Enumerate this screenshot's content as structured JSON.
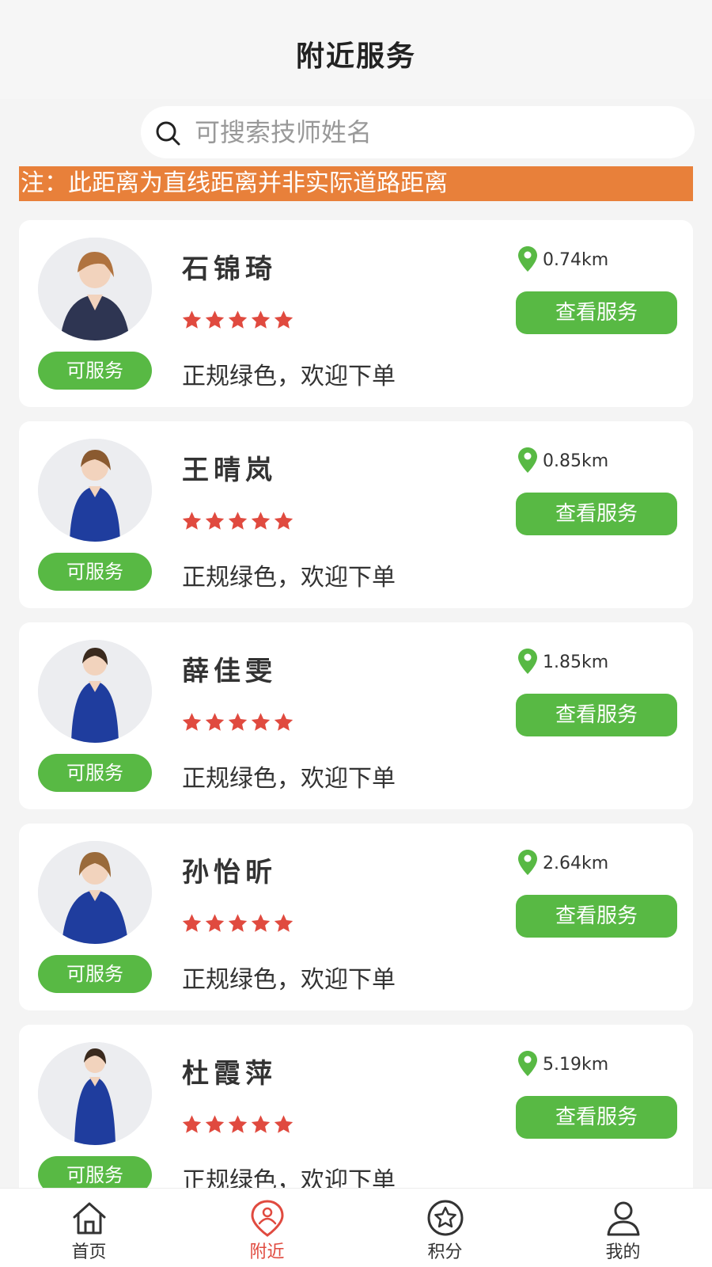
{
  "header": {
    "title": "附近服务"
  },
  "search": {
    "placeholder": "可搜索技师姓名"
  },
  "notice": "注：此距离为直线距离并非实际道路距离",
  "colors": {
    "accent_green": "#58b944",
    "notice_orange": "#e8803a",
    "star_red": "#e04a3f",
    "active_tab": "#e04a3f"
  },
  "technicians": [
    {
      "name": "石锦琦",
      "rating": 5,
      "distance": "0.74km",
      "status": "可服务",
      "description": "正规绿色，欢迎下单",
      "action": "查看服务"
    },
    {
      "name": "王晴岚",
      "rating": 5,
      "distance": "0.85km",
      "status": "可服务",
      "description": "正规绿色，欢迎下单",
      "action": "查看服务"
    },
    {
      "name": "薛佳雯",
      "rating": 5,
      "distance": "1.85km",
      "status": "可服务",
      "description": "正规绿色，欢迎下单",
      "action": "查看服务"
    },
    {
      "name": "孙怡昕",
      "rating": 5,
      "distance": "2.64km",
      "status": "可服务",
      "description": "正规绿色，欢迎下单",
      "action": "查看服务"
    },
    {
      "name": "杜霞萍",
      "rating": 5,
      "distance": "5.19km",
      "status": "可服务",
      "description": "正规绿色，欢迎下单",
      "action": "查看服务"
    }
  ],
  "tabbar": {
    "items": [
      {
        "label": "首页",
        "icon": "home-icon",
        "active": false
      },
      {
        "label": "附近",
        "icon": "nearby-icon",
        "active": true
      },
      {
        "label": "积分",
        "icon": "points-star-icon",
        "active": false
      },
      {
        "label": "我的",
        "icon": "profile-icon",
        "active": false
      }
    ]
  }
}
